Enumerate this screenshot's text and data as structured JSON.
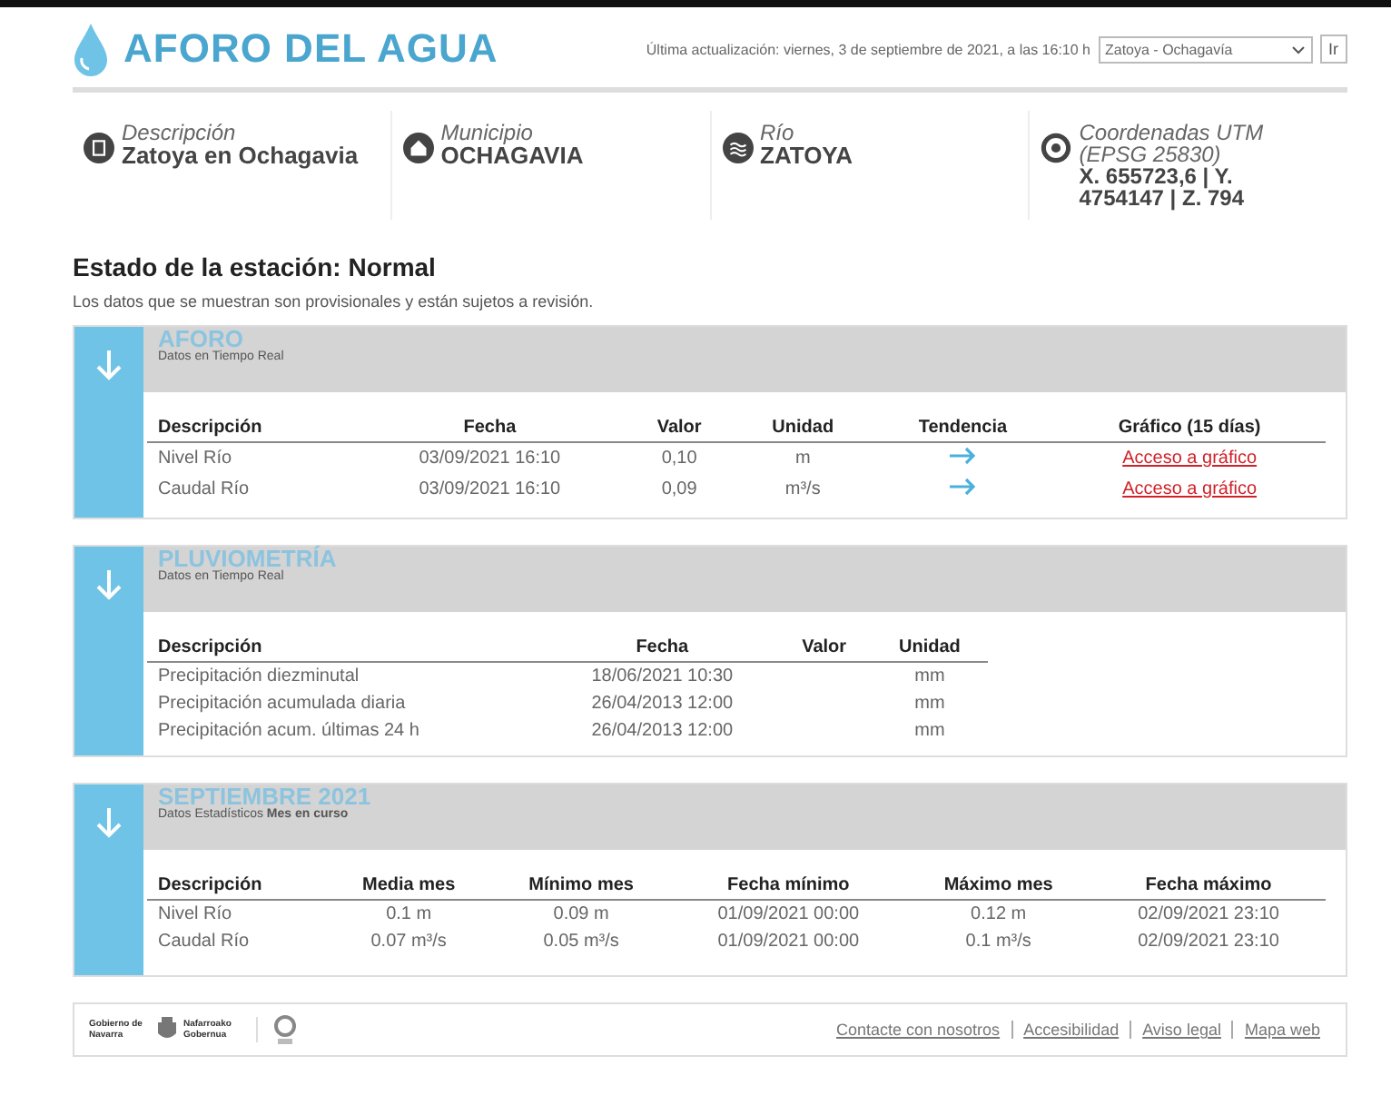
{
  "header": {
    "logo_text": "AFORO DEL AGUA",
    "update_text": "Última actualización: viernes, 3 de septiembre de 2021, a las 16:10 h",
    "station_select": "Zatoya - Ochagavía",
    "go_button": "Ir"
  },
  "info": [
    {
      "kind": "description",
      "label": "Descripción",
      "value": "Zatoya en Ochagavia"
    },
    {
      "kind": "municipality",
      "label": "Municipio",
      "value": "OCHAGAVIA"
    },
    {
      "kind": "river",
      "label": "Río",
      "value": "ZATOYA"
    },
    {
      "kind": "coordinates",
      "label": "Coordenadas UTM (EPSG 25830)",
      "value": "X. 655723,6 | Y. 4754147 | Z. 794"
    }
  ],
  "status": {
    "title": "Estado de la estación: Normal",
    "note": "Los datos que se muestran son provisionales y están sujetos a revisión."
  },
  "sections": [
    {
      "title": "AFORO",
      "subtitle": "Datos en Tiempo Real",
      "columns": [
        "Descripción",
        "Fecha",
        "Valor",
        "Unidad",
        "Tendencia",
        "Gráfico (15 días)"
      ],
      "rows": [
        [
          {
            "kind": "text",
            "text": "Nivel Río"
          },
          {
            "kind": "text",
            "text": "03/09/2021 16:10"
          },
          {
            "kind": "text",
            "text": "0,10"
          },
          {
            "kind": "text",
            "text": "m"
          },
          {
            "kind": "arrow"
          },
          {
            "kind": "link",
            "text": "Acceso a gráfico"
          }
        ],
        [
          {
            "kind": "text",
            "text": "Caudal Río"
          },
          {
            "kind": "text",
            "text": "03/09/2021 16:10"
          },
          {
            "kind": "text",
            "text": "0,09"
          },
          {
            "kind": "text",
            "text": "m³/s"
          },
          {
            "kind": "arrow"
          },
          {
            "kind": "link",
            "text": "Acceso a gráfico"
          }
        ]
      ]
    },
    {
      "title": "PLUVIOMETRÍA",
      "subtitle": "Datos en Tiempo Real",
      "columns": [
        "Descripción",
        "Fecha",
        "Valor",
        "Unidad"
      ],
      "rows": [
        [
          {
            "kind": "text",
            "text": "Precipitación diezminutal"
          },
          {
            "kind": "text",
            "text": "18/06/2021 10:30"
          },
          {
            "kind": "blank"
          },
          {
            "kind": "text",
            "text": "mm"
          }
        ],
        [
          {
            "kind": "text",
            "text": "Precipitación acumulada diaria"
          },
          {
            "kind": "text",
            "text": "26/04/2013 12:00"
          },
          {
            "kind": "blank"
          },
          {
            "kind": "text",
            "text": "mm"
          }
        ],
        [
          {
            "kind": "text",
            "text": "Precipitación acum. últimas 24 h"
          },
          {
            "kind": "text",
            "text": "26/04/2013 12:00"
          },
          {
            "kind": "blank"
          },
          {
            "kind": "text",
            "text": "mm"
          }
        ]
      ]
    },
    {
      "title": "SEPTIEMBRE 2021",
      "subtitle": "Datos Estadísticos **Mes en curso**",
      "columns": [
        "Descripción",
        "Media mes",
        "Mínimo mes",
        "Fecha mínimo",
        "Máximo mes",
        "Fecha máximo"
      ],
      "rows": [
        [
          {
            "kind": "text",
            "text": "Nivel Río"
          },
          {
            "kind": "text",
            "text": "0.1 m"
          },
          {
            "kind": "text",
            "text": "0.09 m"
          },
          {
            "kind": "text",
            "text": "01/09/2021 00:00"
          },
          {
            "kind": "text",
            "text": "0.12 m"
          },
          {
            "kind": "text",
            "text": "02/09/2021 23:10"
          }
        ],
        [
          {
            "kind": "text",
            "text": "Caudal Río"
          },
          {
            "kind": "text",
            "text": "0.07 m³/s"
          },
          {
            "kind": "text",
            "text": "0.05 m³/s"
          },
          {
            "kind": "text",
            "text": "01/09/2021 00:00"
          },
          {
            "kind": "text",
            "text": "0.1 m³/s"
          },
          {
            "kind": "text",
            "text": "02/09/2021 23:10"
          }
        ]
      ]
    }
  ],
  "footer": {
    "logo_left": "Gobierno de Navarra",
    "logo_right": "Nafarroako Gobernua",
    "links": [
      "Contacte con nosotros",
      "Accesibilidad",
      "Aviso legal",
      "Mapa web"
    ]
  }
}
